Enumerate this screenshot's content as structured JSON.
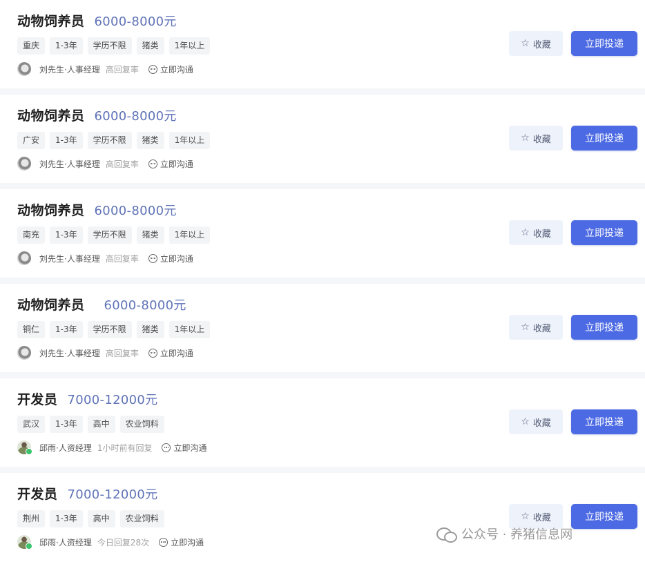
{
  "jobs": [
    {
      "title": "动物饲养员",
      "salary": "6000-8000元",
      "tags": [
        "重庆",
        "1-3年",
        "学历不限",
        "猪类",
        "1年以上"
      ],
      "recruiter": {
        "name": "刘先生·人事经理",
        "reply": "高回复率"
      },
      "chat_label": "立即沟通",
      "favorite_label": "收藏",
      "apply_label": "立即投递"
    },
    {
      "title": "动物饲养员",
      "salary": "6000-8000元",
      "tags": [
        "广安",
        "1-3年",
        "学历不限",
        "猪类",
        "1年以上"
      ],
      "recruiter": {
        "name": "刘先生·人事经理",
        "reply": "高回复率"
      },
      "chat_label": "立即沟通",
      "favorite_label": "收藏",
      "apply_label": "立即投递"
    },
    {
      "title": "动物饲养员",
      "salary": "6000-8000元",
      "tags": [
        "南充",
        "1-3年",
        "学历不限",
        "猪类",
        "1年以上"
      ],
      "recruiter": {
        "name": "刘先生·人事经理",
        "reply": "高回复率"
      },
      "chat_label": "立即沟通",
      "favorite_label": "收藏",
      "apply_label": "立即投递"
    },
    {
      "title": "动物饲养员",
      "salary": "6000-8000元",
      "tags": [
        "铜仁",
        "1-3年",
        "学历不限",
        "猪类",
        "1年以上"
      ],
      "recruiter": {
        "name": "刘先生·人事经理",
        "reply": "高回复率"
      },
      "chat_label": "立即沟通",
      "favorite_label": "收藏",
      "apply_label": "立即投递"
    },
    {
      "title": "开发员",
      "salary": "7000-12000元",
      "tags": [
        "武汉",
        "1-3年",
        "高中",
        "农业饲料"
      ],
      "recruiter": {
        "name": "邱雨·人资经理",
        "reply": "1小时前有回复"
      },
      "chat_label": "立即沟通",
      "favorite_label": "收藏",
      "apply_label": "立即投递"
    },
    {
      "title": "开发员",
      "salary": "7000-12000元",
      "tags": [
        "荆州",
        "1-3年",
        "高中",
        "农业饲料"
      ],
      "recruiter": {
        "name": "邱雨·人资经理",
        "reply": "今日回复28次"
      },
      "chat_label": "立即沟通",
      "favorite_label": "收藏",
      "apply_label": "立即投递"
    }
  ],
  "watermark": {
    "text": "公众号 · 养猪信息网",
    "icon": "wechat-icon"
  },
  "colors": {
    "accent": "#4c6ae3",
    "salary": "#5f73b8",
    "online": "#3cc46d"
  }
}
